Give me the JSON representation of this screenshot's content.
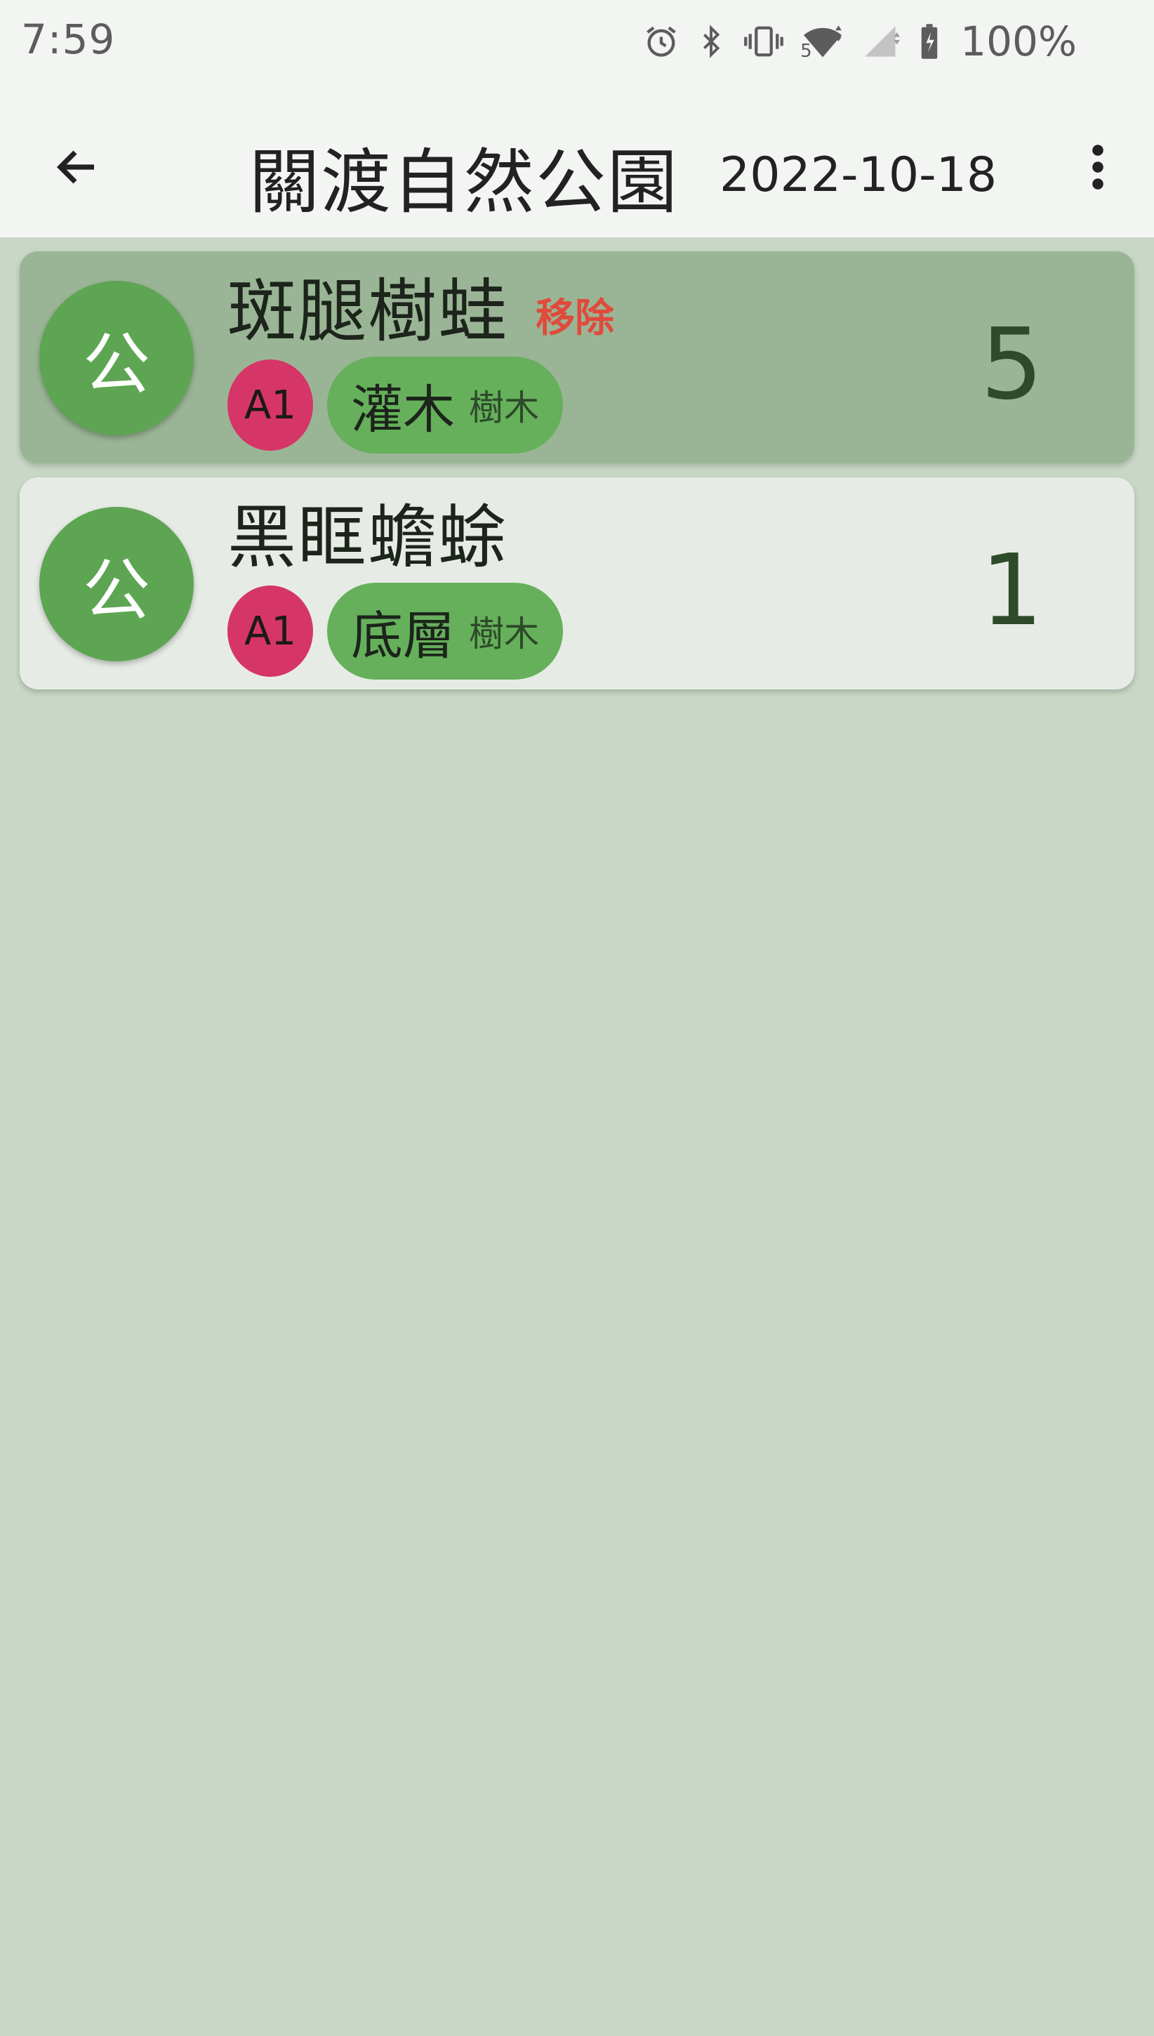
{
  "status_bar": {
    "time": "7:59",
    "network_label": "5",
    "battery": "100%",
    "icons": [
      "alarm-icon",
      "bluetooth-icon",
      "vibrate-icon",
      "wifi-icon",
      "signal-icon",
      "battery-charging-icon"
    ]
  },
  "app_bar": {
    "back_icon": "arrow-left-icon",
    "title": "關渡自然公園",
    "date": "2022-10-18",
    "menu_icon": "more-vert-icon"
  },
  "colors": {
    "app_bar_bg": "#f3f5f3",
    "page_bg": "#c9d7c6",
    "selected_card_bg": "#9ab595",
    "card_bg": "#e6ece5",
    "avatar_green": "#5ea553",
    "zone_badge": "#d63567",
    "layer_chip": "#66b05b",
    "remove_red": "#e04a3c"
  },
  "records": [
    {
      "avatar": "公",
      "name": "斑腿樹蛙",
      "action": "移除",
      "zone": "A1",
      "layer": "灌木",
      "group": "樹木",
      "count": "5",
      "selected": true
    },
    {
      "avatar": "公",
      "name": "黑眶蟾蜍",
      "zone": "A1",
      "layer": "底層",
      "group": "樹木",
      "count": "1",
      "selected": false
    }
  ]
}
